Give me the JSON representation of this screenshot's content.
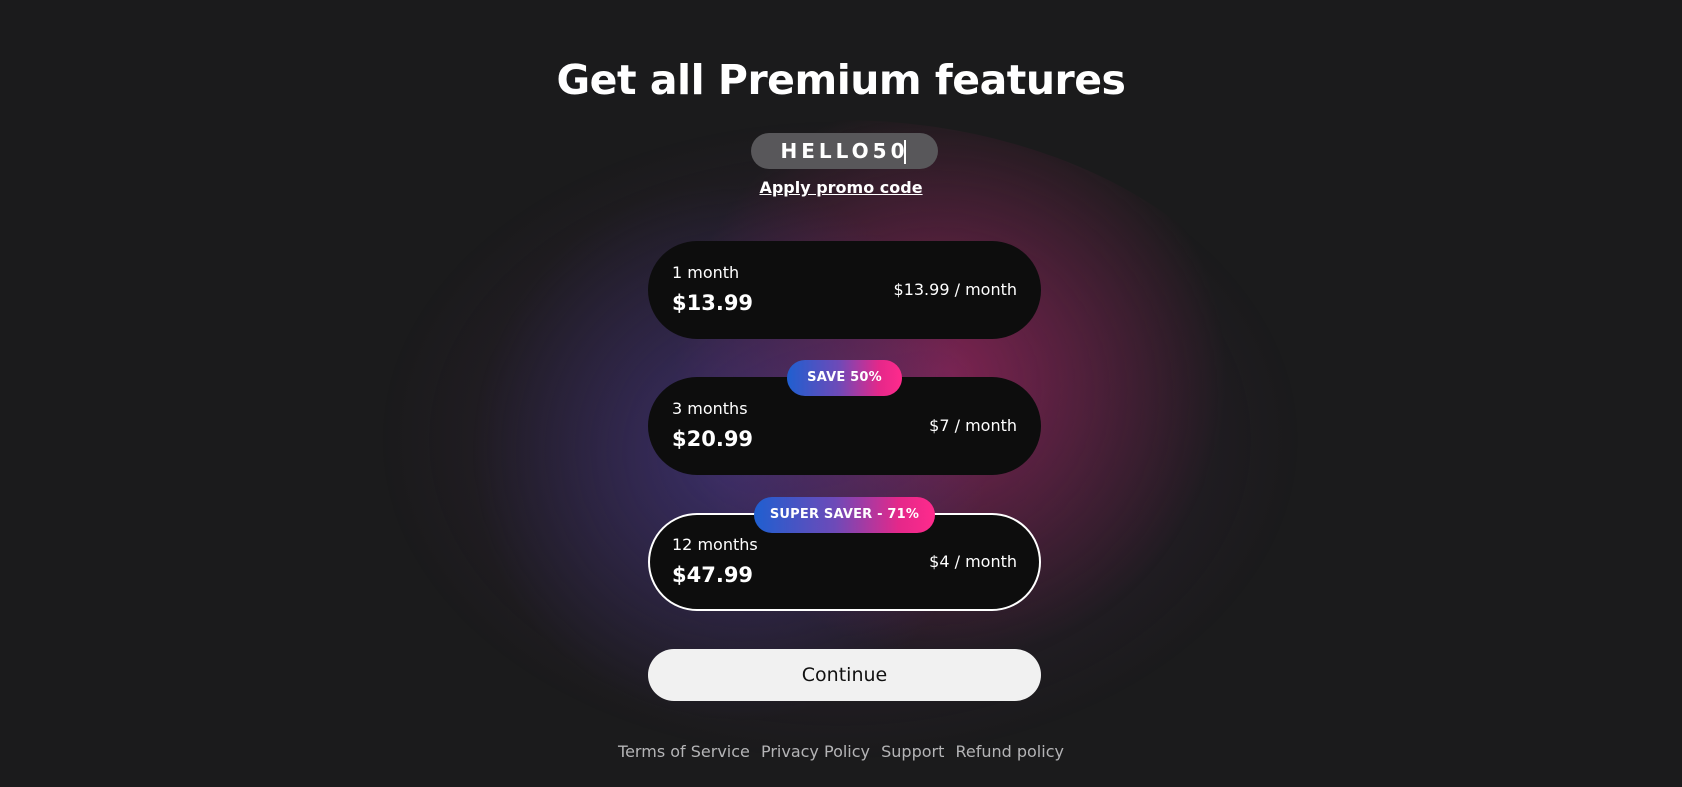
{
  "page": {
    "title": "Get all Premium features"
  },
  "promo": {
    "value": "HELLO50",
    "apply_label": "Apply promo code"
  },
  "plans": [
    {
      "duration": "1 month",
      "price": "$13.99",
      "per_month": "$13.99 / month",
      "badge": "",
      "selected": false
    },
    {
      "duration": "3 months",
      "price": "$20.99",
      "per_month": "$7 / month",
      "badge": "SAVE 50%",
      "selected": false
    },
    {
      "duration": "12 months",
      "price": "$47.99",
      "per_month": "$4 / month",
      "badge": "SUPER SAVER - 71%",
      "selected": true
    }
  ],
  "continue_label": "Continue",
  "footer": {
    "links": [
      "Terms of Service",
      "Privacy Policy",
      "Support",
      "Refund policy"
    ]
  },
  "colors": {
    "background": "#1b1b1c",
    "card": "#0d0d0d",
    "badge_gradient_start": "#1f5fd0",
    "badge_gradient_end": "#ff2a8c",
    "button": "#f1f1f1",
    "footer_text": "#b4b4b6"
  }
}
